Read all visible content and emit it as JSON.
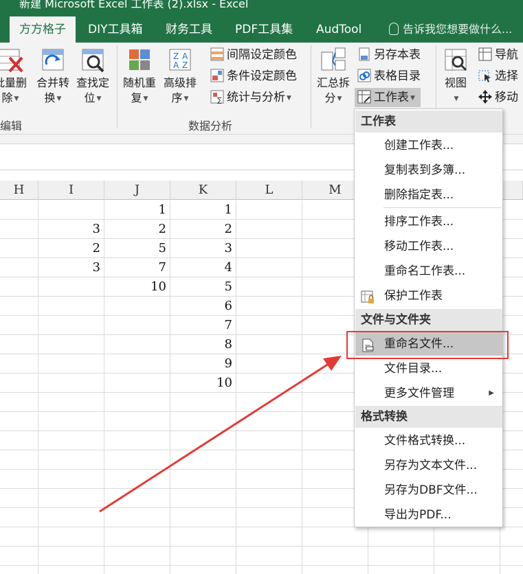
{
  "window": {
    "title": "新建 Microsoft Excel 工作表 (2).xlsx - Excel"
  },
  "tabs": [
    {
      "label": "方方格子",
      "active": true
    },
    {
      "label": "DIY工具箱"
    },
    {
      "label": "财务工具"
    },
    {
      "label": "PDF工具集"
    },
    {
      "label": "AudTool"
    }
  ],
  "tell_me": "告诉我您想要做什么...",
  "ribbon": {
    "group_edit": {
      "label": "编辑",
      "buttons": [
        {
          "l1": "批量删",
          "l2": "除",
          "icon": "batch-delete-icon"
        },
        {
          "l1": "合并转",
          "l2": "换",
          "icon": "merge-convert-icon"
        },
        {
          "l1": "查找定",
          "l2": "位",
          "icon": "find-locate-icon"
        }
      ]
    },
    "group_analysis": {
      "label": "数据分析",
      "buttons": [
        {
          "l1": "随机重",
          "l2": "复",
          "icon": "random-repeat-icon"
        },
        {
          "l1": "高级排",
          "l2": "序",
          "icon": "advanced-sort-icon"
        }
      ],
      "small": [
        {
          "label": "间隔设定颜色",
          "icon": "interval-color-icon"
        },
        {
          "label": "条件设定颜色",
          "icon": "condition-color-icon"
        },
        {
          "label": "统计与分析",
          "icon": "statistics-icon"
        }
      ]
    },
    "group_sheet": {
      "big": {
        "l1": "汇总拆",
        "l2": "分",
        "icon": "summarize-split-icon"
      },
      "small": [
        {
          "label": "另存本表",
          "icon": "save-sheet-icon"
        },
        {
          "label": "表格目录",
          "icon": "sheet-directory-icon"
        },
        {
          "label": "工作表",
          "icon": "worksheet-icon"
        }
      ]
    },
    "group_view": {
      "big": {
        "l1": "视图",
        "l2": "",
        "icon": "view-icon"
      },
      "small": [
        {
          "label": "导航",
          "icon": "navigation-icon"
        },
        {
          "label": "选择",
          "icon": "select-icon"
        },
        {
          "label": "移动",
          "icon": "move-icon"
        }
      ]
    }
  },
  "sheet": {
    "columns": [
      "H",
      "I",
      "J",
      "K",
      "L",
      "M"
    ],
    "rows": [
      {
        "I": "",
        "J": "1",
        "K": "1"
      },
      {
        "I": "3",
        "J": "2",
        "K": "2"
      },
      {
        "I": "2",
        "J": "5",
        "K": "3"
      },
      {
        "I": "3",
        "J": "7",
        "K": "4"
      },
      {
        "I": "",
        "J": "10",
        "K": "5"
      },
      {
        "I": "",
        "J": "",
        "K": "6"
      },
      {
        "I": "",
        "J": "",
        "K": "7"
      },
      {
        "I": "",
        "J": "",
        "K": "8"
      },
      {
        "I": "",
        "J": "",
        "K": "9"
      },
      {
        "I": "",
        "J": "",
        "K": "10"
      }
    ]
  },
  "menu": {
    "sections": [
      {
        "header": "工作表",
        "items": [
          {
            "label": "创建工作表..."
          },
          {
            "label": "复制表到多簿..."
          },
          {
            "label": "删除指定表..."
          },
          {
            "label": "排序工作表..."
          },
          {
            "label": "移动工作表..."
          },
          {
            "label": "重命名工作表..."
          },
          {
            "label": "保护工作表",
            "icon": "protect-sheet-icon"
          }
        ]
      },
      {
        "header": "文件与文件夹",
        "items": [
          {
            "label": "重命名文件...",
            "icon": "rename-file-icon",
            "highlighted": true
          },
          {
            "label": "文件目录..."
          },
          {
            "label": "更多文件管理",
            "submenu": true
          }
        ]
      },
      {
        "header": "格式转换",
        "items": [
          {
            "label": "文件格式转换..."
          },
          {
            "label": "另存为文本文件..."
          },
          {
            "label": "另存为DBF文件..."
          },
          {
            "label": "导出为PDF..."
          }
        ]
      }
    ]
  },
  "annotation": {
    "color": "#e53935"
  }
}
